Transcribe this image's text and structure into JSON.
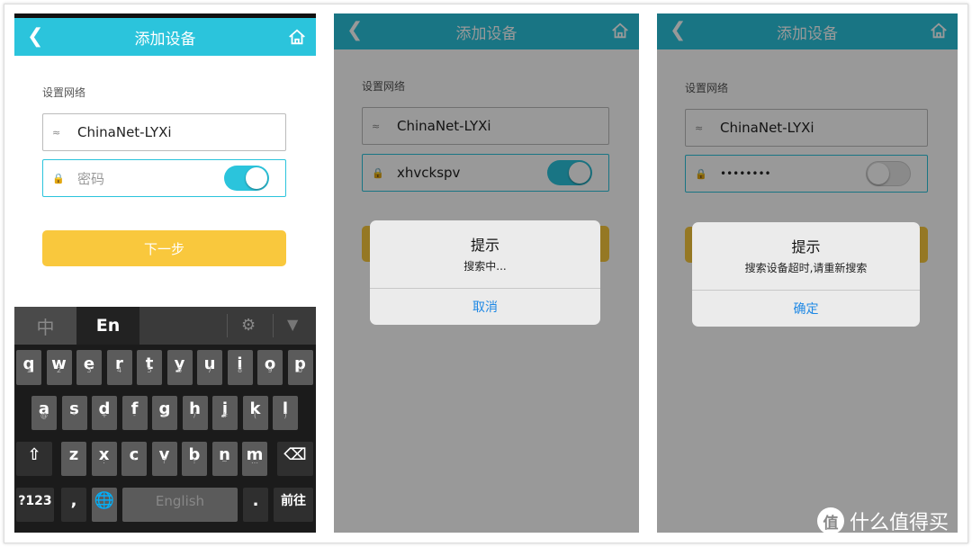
{
  "title": "添加设备",
  "section_label": "设置网络",
  "ssid": "ChinaNet-LYXi",
  "colors": {
    "header": "#2bc4dc",
    "header_dim": "#1a7d89",
    "accent": "#2bc4dc",
    "button": "#f9c83d",
    "link": "#1e88e5"
  },
  "screen1": {
    "password_placeholder": "密码",
    "toggle_on": true,
    "next_button": "下一步"
  },
  "screen2": {
    "password": "xhvckspv",
    "toggle_on": true,
    "dialog": {
      "title": "提示",
      "message": "搜索中...",
      "action": "取消"
    }
  },
  "screen3": {
    "password": "••••••••",
    "toggle_on": false,
    "dialog": {
      "title": "提示",
      "message": "搜索设备超时,请重新搜索",
      "action": "确定"
    }
  },
  "keyboard": {
    "tab_chinese": "中",
    "tab_english": "En",
    "row1": [
      [
        "q",
        "1"
      ],
      [
        "w",
        "2"
      ],
      [
        "e",
        "3"
      ],
      [
        "r",
        "4"
      ],
      [
        "t",
        "5"
      ],
      [
        "y",
        "6"
      ],
      [
        "u",
        "7"
      ],
      [
        "i",
        "8"
      ],
      [
        "o",
        "9"
      ],
      [
        "p",
        "0"
      ]
    ],
    "row2": [
      [
        "a",
        "@"
      ],
      [
        "s",
        "*"
      ],
      [
        "d",
        "+"
      ],
      [
        "f",
        "-"
      ],
      [
        "g",
        "="
      ],
      [
        "h",
        "/"
      ],
      [
        "j",
        "#"
      ],
      [
        "k",
        "("
      ],
      [
        "l",
        ")"
      ]
    ],
    "row3": [
      [
        "z",
        "'"
      ],
      [
        "x",
        ":"
      ],
      [
        "c",
        "\""
      ],
      [
        "v",
        "?"
      ],
      [
        "b",
        "!"
      ],
      [
        "n",
        "~"
      ],
      [
        "m",
        "…"
      ]
    ],
    "symbols": "?123",
    "comma": ",",
    "space": "English",
    "period": ".",
    "enter": "前往"
  },
  "watermark": {
    "logo": "值",
    "text": "什么值得买"
  }
}
